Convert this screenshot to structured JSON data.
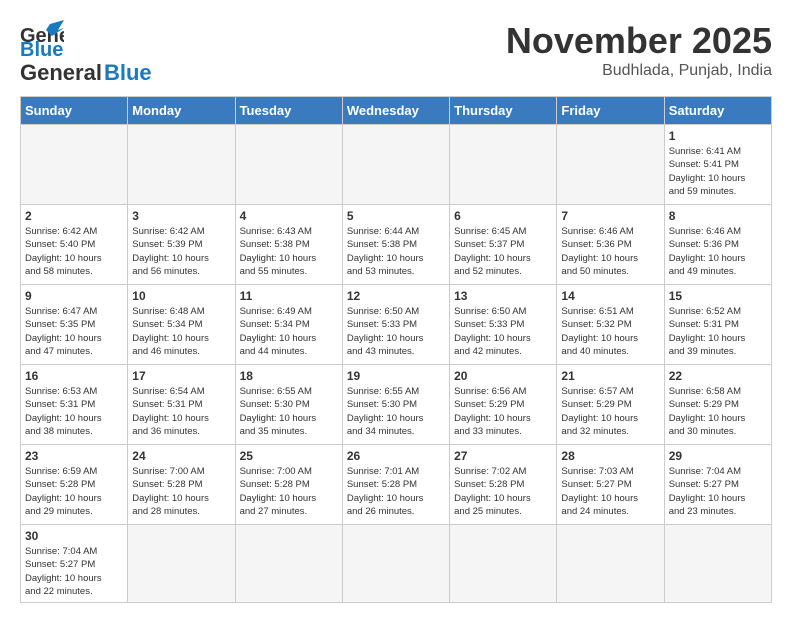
{
  "header": {
    "logo_general": "General",
    "logo_blue": "Blue",
    "month_title": "November 2025",
    "location": "Budhlada, Punjab, India"
  },
  "weekdays": [
    "Sunday",
    "Monday",
    "Tuesday",
    "Wednesday",
    "Thursday",
    "Friday",
    "Saturday"
  ],
  "weeks": [
    [
      {
        "day": "",
        "info": ""
      },
      {
        "day": "",
        "info": ""
      },
      {
        "day": "",
        "info": ""
      },
      {
        "day": "",
        "info": ""
      },
      {
        "day": "",
        "info": ""
      },
      {
        "day": "",
        "info": ""
      },
      {
        "day": "1",
        "info": "Sunrise: 6:41 AM\nSunset: 5:41 PM\nDaylight: 10 hours\nand 59 minutes."
      }
    ],
    [
      {
        "day": "2",
        "info": "Sunrise: 6:42 AM\nSunset: 5:40 PM\nDaylight: 10 hours\nand 58 minutes."
      },
      {
        "day": "3",
        "info": "Sunrise: 6:42 AM\nSunset: 5:39 PM\nDaylight: 10 hours\nand 56 minutes."
      },
      {
        "day": "4",
        "info": "Sunrise: 6:43 AM\nSunset: 5:38 PM\nDaylight: 10 hours\nand 55 minutes."
      },
      {
        "day": "5",
        "info": "Sunrise: 6:44 AM\nSunset: 5:38 PM\nDaylight: 10 hours\nand 53 minutes."
      },
      {
        "day": "6",
        "info": "Sunrise: 6:45 AM\nSunset: 5:37 PM\nDaylight: 10 hours\nand 52 minutes."
      },
      {
        "day": "7",
        "info": "Sunrise: 6:46 AM\nSunset: 5:36 PM\nDaylight: 10 hours\nand 50 minutes."
      },
      {
        "day": "8",
        "info": "Sunrise: 6:46 AM\nSunset: 5:36 PM\nDaylight: 10 hours\nand 49 minutes."
      }
    ],
    [
      {
        "day": "9",
        "info": "Sunrise: 6:47 AM\nSunset: 5:35 PM\nDaylight: 10 hours\nand 47 minutes."
      },
      {
        "day": "10",
        "info": "Sunrise: 6:48 AM\nSunset: 5:34 PM\nDaylight: 10 hours\nand 46 minutes."
      },
      {
        "day": "11",
        "info": "Sunrise: 6:49 AM\nSunset: 5:34 PM\nDaylight: 10 hours\nand 44 minutes."
      },
      {
        "day": "12",
        "info": "Sunrise: 6:50 AM\nSunset: 5:33 PM\nDaylight: 10 hours\nand 43 minutes."
      },
      {
        "day": "13",
        "info": "Sunrise: 6:50 AM\nSunset: 5:33 PM\nDaylight: 10 hours\nand 42 minutes."
      },
      {
        "day": "14",
        "info": "Sunrise: 6:51 AM\nSunset: 5:32 PM\nDaylight: 10 hours\nand 40 minutes."
      },
      {
        "day": "15",
        "info": "Sunrise: 6:52 AM\nSunset: 5:31 PM\nDaylight: 10 hours\nand 39 minutes."
      }
    ],
    [
      {
        "day": "16",
        "info": "Sunrise: 6:53 AM\nSunset: 5:31 PM\nDaylight: 10 hours\nand 38 minutes."
      },
      {
        "day": "17",
        "info": "Sunrise: 6:54 AM\nSunset: 5:31 PM\nDaylight: 10 hours\nand 36 minutes."
      },
      {
        "day": "18",
        "info": "Sunrise: 6:55 AM\nSunset: 5:30 PM\nDaylight: 10 hours\nand 35 minutes."
      },
      {
        "day": "19",
        "info": "Sunrise: 6:55 AM\nSunset: 5:30 PM\nDaylight: 10 hours\nand 34 minutes."
      },
      {
        "day": "20",
        "info": "Sunrise: 6:56 AM\nSunset: 5:29 PM\nDaylight: 10 hours\nand 33 minutes."
      },
      {
        "day": "21",
        "info": "Sunrise: 6:57 AM\nSunset: 5:29 PM\nDaylight: 10 hours\nand 32 minutes."
      },
      {
        "day": "22",
        "info": "Sunrise: 6:58 AM\nSunset: 5:29 PM\nDaylight: 10 hours\nand 30 minutes."
      }
    ],
    [
      {
        "day": "23",
        "info": "Sunrise: 6:59 AM\nSunset: 5:28 PM\nDaylight: 10 hours\nand 29 minutes."
      },
      {
        "day": "24",
        "info": "Sunrise: 7:00 AM\nSunset: 5:28 PM\nDaylight: 10 hours\nand 28 minutes."
      },
      {
        "day": "25",
        "info": "Sunrise: 7:00 AM\nSunset: 5:28 PM\nDaylight: 10 hours\nand 27 minutes."
      },
      {
        "day": "26",
        "info": "Sunrise: 7:01 AM\nSunset: 5:28 PM\nDaylight: 10 hours\nand 26 minutes."
      },
      {
        "day": "27",
        "info": "Sunrise: 7:02 AM\nSunset: 5:28 PM\nDaylight: 10 hours\nand 25 minutes."
      },
      {
        "day": "28",
        "info": "Sunrise: 7:03 AM\nSunset: 5:27 PM\nDaylight: 10 hours\nand 24 minutes."
      },
      {
        "day": "29",
        "info": "Sunrise: 7:04 AM\nSunset: 5:27 PM\nDaylight: 10 hours\nand 23 minutes."
      }
    ],
    [
      {
        "day": "30",
        "info": "Sunrise: 7:04 AM\nSunset: 5:27 PM\nDaylight: 10 hours\nand 22 minutes."
      },
      {
        "day": "",
        "info": ""
      },
      {
        "day": "",
        "info": ""
      },
      {
        "day": "",
        "info": ""
      },
      {
        "day": "",
        "info": ""
      },
      {
        "day": "",
        "info": ""
      },
      {
        "day": "",
        "info": ""
      }
    ]
  ]
}
